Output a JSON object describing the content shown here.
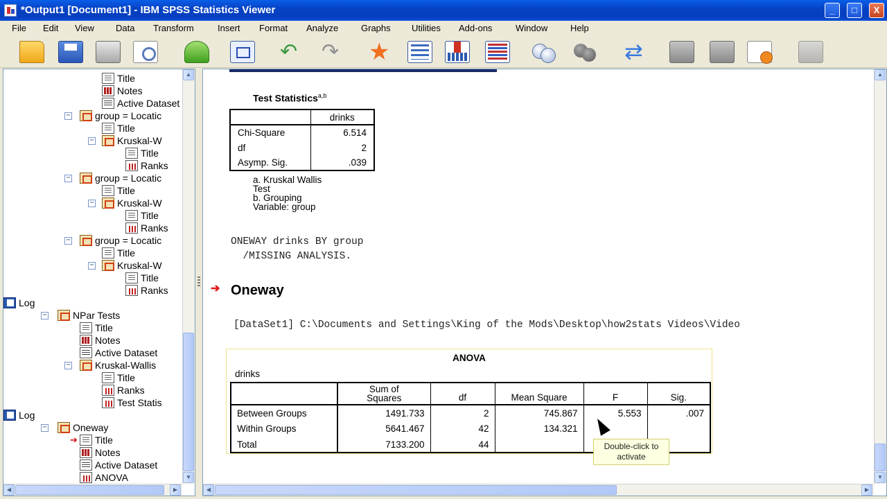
{
  "window": {
    "title": "*Output1 [Document1] - IBM SPSS Statistics Viewer",
    "minimize": "_",
    "maximize": "□",
    "close": "X"
  },
  "menu": [
    "File",
    "Edit",
    "View",
    "Data",
    "Transform",
    "Insert",
    "Format",
    "Analyze",
    "Graphs",
    "Utilities",
    "Add-ons",
    "Window",
    "Help"
  ],
  "toolbar_icons": [
    "open-folder",
    "save-disk",
    "print",
    "print-preview",
    "export",
    "recall-dialog",
    "undo",
    "redo",
    "goto-data",
    "goto-case",
    "insert-variable",
    "variables",
    "use-sets",
    "show-all",
    "select-cases",
    "designate-window",
    "run-script",
    "promote",
    "collapse"
  ],
  "tree": {
    "nodes": [
      {
        "label": "Title",
        "icon": "title"
      },
      {
        "label": "Notes",
        "icon": "notes"
      },
      {
        "label": "Active Dataset",
        "icon": "dataset"
      },
      {
        "label": "group = Locatic",
        "icon": "book"
      },
      {
        "label": "Title",
        "icon": "title"
      },
      {
        "label": "Kruskal-W",
        "icon": "book"
      },
      {
        "label": "Title",
        "icon": "title"
      },
      {
        "label": "Ranks",
        "icon": "table"
      },
      {
        "label": "group = Locatic",
        "icon": "book"
      },
      {
        "label": "Title",
        "icon": "title"
      },
      {
        "label": "Kruskal-W",
        "icon": "book"
      },
      {
        "label": "Title",
        "icon": "title"
      },
      {
        "label": "Ranks",
        "icon": "table"
      },
      {
        "label": "group = Locatic",
        "icon": "book"
      },
      {
        "label": "Title",
        "icon": "title"
      },
      {
        "label": "Kruskal-W",
        "icon": "book"
      },
      {
        "label": "Title",
        "icon": "title"
      },
      {
        "label": "Ranks",
        "icon": "table"
      },
      {
        "label": "Log",
        "icon": "log"
      },
      {
        "label": "NPar Tests",
        "icon": "book"
      },
      {
        "label": "Title",
        "icon": "title"
      },
      {
        "label": "Notes",
        "icon": "notes"
      },
      {
        "label": "Active Dataset",
        "icon": "dataset"
      },
      {
        "label": "Kruskal-Wallis",
        "icon": "book"
      },
      {
        "label": "Title",
        "icon": "title"
      },
      {
        "label": "Ranks",
        "icon": "table"
      },
      {
        "label": "Test Statis",
        "icon": "table"
      },
      {
        "label": "Log",
        "icon": "log"
      },
      {
        "label": "Oneway",
        "icon": "book"
      },
      {
        "label": "Title",
        "icon": "title"
      },
      {
        "label": "Notes",
        "icon": "notes"
      },
      {
        "label": "Active Dataset",
        "icon": "dataset"
      },
      {
        "label": "ANOVA",
        "icon": "table"
      }
    ]
  },
  "test_statistics": {
    "title": "Test Statistics",
    "superscript": "a,b",
    "column_header": "drinks",
    "rows": [
      {
        "label": "Chi-Square",
        "value": "6.514"
      },
      {
        "label": "df",
        "value": "2"
      },
      {
        "label": "Asymp. Sig.",
        "value": ".039"
      }
    ],
    "footnote_a1": "a. Kruskal Wallis",
    "footnote_a2": "Test",
    "footnote_b1": "b. Grouping",
    "footnote_b2": "Variable: group"
  },
  "syntax": {
    "line1": "ONEWAY drinks BY group",
    "line2": "  /MISSING ANALYSIS."
  },
  "oneway": {
    "heading": "Oneway",
    "dataset_line": "[DataSet1] C:\\Documents and Settings\\King of the Mods\\Desktop\\how2stats Videos\\Video"
  },
  "anova": {
    "title": "ANOVA",
    "dependent": "drinks",
    "headers": {
      "ss_line1": "Sum of",
      "ss_line2": "Squares",
      "df": "df",
      "ms": "Mean Square",
      "f": "F",
      "sig": "Sig."
    },
    "rows": [
      {
        "label": "Between Groups",
        "ss": "1491.733",
        "df": "2",
        "ms": "745.867",
        "f": "5.553",
        "sig": ".007"
      },
      {
        "label": "Within Groups",
        "ss": "5641.467",
        "df": "42",
        "ms": "134.321",
        "f": "",
        "sig": ""
      },
      {
        "label": "Total",
        "ss": "7133.200",
        "df": "44",
        "ms": "",
        "f": "",
        "sig": ""
      }
    ]
  },
  "tooltip": {
    "line1": "Double-click to",
    "line2": "activate"
  }
}
